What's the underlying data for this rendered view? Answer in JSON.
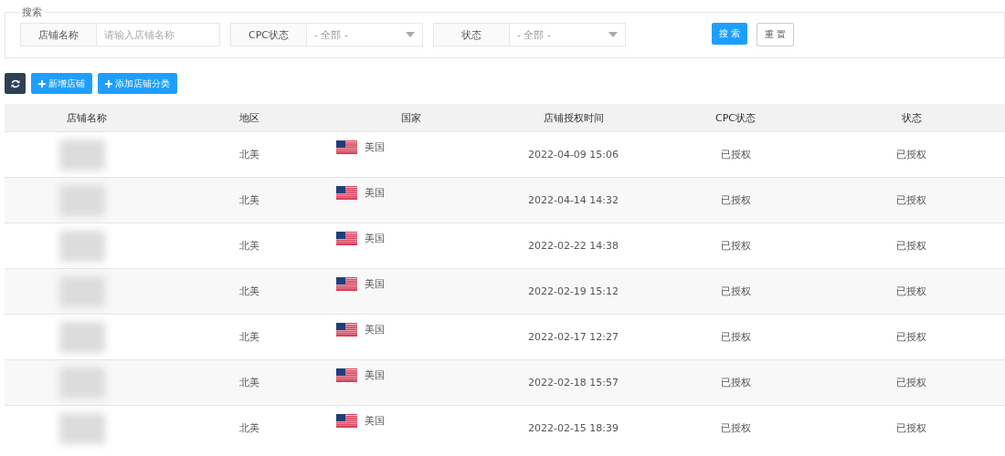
{
  "search": {
    "legend": "搜索",
    "fields": [
      {
        "kind": "text",
        "label": "店铺名称",
        "placeholder": "请输入店铺名称"
      },
      {
        "kind": "select",
        "label": "CPC状态",
        "value": "- 全部 -"
      },
      {
        "kind": "select",
        "label": "状态",
        "value": "- 全部 -"
      }
    ],
    "search_button": "搜 索",
    "reset_button": "重 置"
  },
  "toolbar": {
    "add_store": "新增店铺",
    "add_category": "添加店铺分类"
  },
  "table": {
    "columns": [
      "店铺名称",
      "地区",
      "国家",
      "店铺授权时间",
      "CPC状态",
      "状态"
    ],
    "rows": [
      {
        "region": "北美",
        "country": "美国",
        "auth_time": "2022-04-09 15:06",
        "cpc_status": "已授权",
        "status": "已授权"
      },
      {
        "region": "北美",
        "country": "美国",
        "auth_time": "2022-04-14 14:32",
        "cpc_status": "已授权",
        "status": "已授权"
      },
      {
        "region": "北美",
        "country": "美国",
        "auth_time": "2022-02-22 14:38",
        "cpc_status": "已授权",
        "status": "已授权"
      },
      {
        "region": "北美",
        "country": "美国",
        "auth_time": "2022-02-19 15:12",
        "cpc_status": "已授权",
        "status": "已授权"
      },
      {
        "region": "北美",
        "country": "美国",
        "auth_time": "2022-02-17 12:27",
        "cpc_status": "已授权",
        "status": "已授权"
      },
      {
        "region": "北美",
        "country": "美国",
        "auth_time": "2022-02-18 15:57",
        "cpc_status": "已授权",
        "status": "已授权"
      },
      {
        "region": "北美",
        "country": "美国",
        "auth_time": "2022-02-15 18:39",
        "cpc_status": "已授权",
        "status": "已授权"
      }
    ]
  }
}
